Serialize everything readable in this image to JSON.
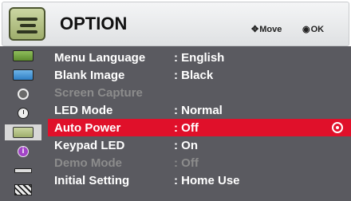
{
  "header": {
    "title": "OPTION",
    "move_hint": "Move",
    "ok_hint": "OK",
    "move_icon": "four-way-arrow-icon",
    "ok_icon": "ok-dot-icon"
  },
  "sidebar": {
    "icons": [
      "picture-icon",
      "screen-icon",
      "audio-icon",
      "time-icon",
      "option-icon",
      "info-icon",
      "usb-icon",
      "media-icon"
    ],
    "active_index": 4
  },
  "menu": {
    "items": [
      {
        "label": "Menu Language",
        "value": ": English",
        "state": "normal"
      },
      {
        "label": "Blank Image",
        "value": ": Black",
        "state": "normal"
      },
      {
        "label": "Screen Capture",
        "value": "",
        "state": "disabled"
      },
      {
        "label": "LED Mode",
        "value": ": Normal",
        "state": "normal"
      },
      {
        "label": "Auto Power",
        "value": ": Off",
        "state": "selected"
      },
      {
        "label": "Keypad LED",
        "value": ": On",
        "state": "normal"
      },
      {
        "label": "Demo Mode",
        "value": ": Off",
        "state": "disabled"
      },
      {
        "label": "Initial Setting",
        "value": ": Home Use",
        "state": "normal"
      }
    ]
  },
  "colors": {
    "selected_row": "#e0102a",
    "menu_background": "#5a5a60",
    "disabled_text": "#8c8c8c"
  }
}
